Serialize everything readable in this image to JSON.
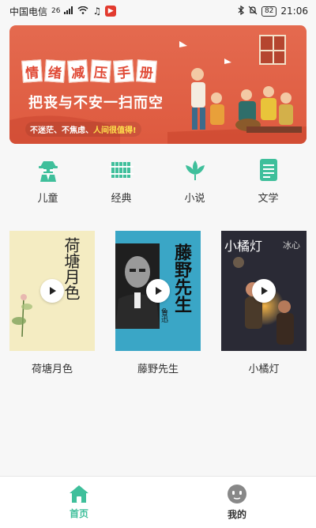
{
  "status_bar": {
    "carrier": "中国电信",
    "network_badge": "26",
    "battery": "82",
    "time": "21:06"
  },
  "banner": {
    "headline_chars": [
      "情",
      "绪",
      "减",
      "压",
      "手",
      "册"
    ],
    "subtitle": "把丧与不安一扫而空",
    "tagline_prefix": "不迷茫、不焦虑、",
    "tagline_highlight": "人间很值得!"
  },
  "categories": [
    {
      "label": "儿童",
      "icon": "child-spy-icon"
    },
    {
      "label": "经典",
      "icon": "bamboo-scroll-icon"
    },
    {
      "label": "小说",
      "icon": "lotus-icon"
    },
    {
      "label": "文学",
      "icon": "document-icon"
    }
  ],
  "books": [
    {
      "title": "荷塘月色",
      "cover_title": "荷塘月色"
    },
    {
      "title": "藤野先生",
      "cover_title": "藤野先生",
      "cover_author": "鲁迅"
    },
    {
      "title": "小橘灯",
      "cover_title": "小橘灯",
      "cover_author": "冰心"
    }
  ],
  "tabs": [
    {
      "label": "首页",
      "icon": "home-icon",
      "active": true
    },
    {
      "label": "我的",
      "icon": "profile-face-icon",
      "active": false
    }
  ],
  "colors": {
    "accent": "#3fbf9b",
    "banner_red": "#de5a3f",
    "highlight_yellow": "#ffe14d"
  }
}
